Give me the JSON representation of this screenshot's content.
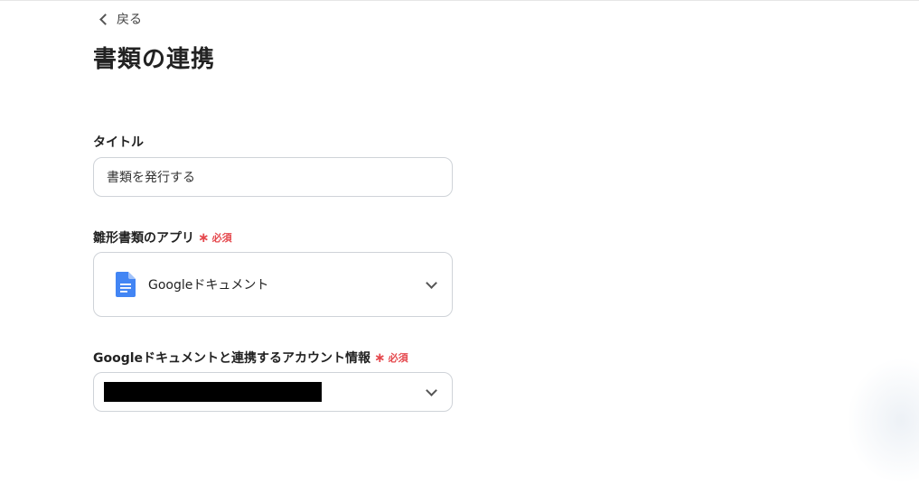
{
  "nav": {
    "back_label": "戻る"
  },
  "page": {
    "title": "書類の連携"
  },
  "form": {
    "title_field": {
      "label": "タイトル",
      "value": "書類を発行する"
    },
    "template_app": {
      "label": "雛形書類のアプリ",
      "required_label": "必須",
      "selected": "Googleドキュメント",
      "icon": "google-docs-icon"
    },
    "account": {
      "label": "Googleドキュメントと連携するアカウント情報",
      "required_label": "必須",
      "value_redacted": true
    }
  },
  "colors": {
    "required": "#e5484d",
    "docs_blue": "#4285f4",
    "border": "#cfd3d8"
  }
}
